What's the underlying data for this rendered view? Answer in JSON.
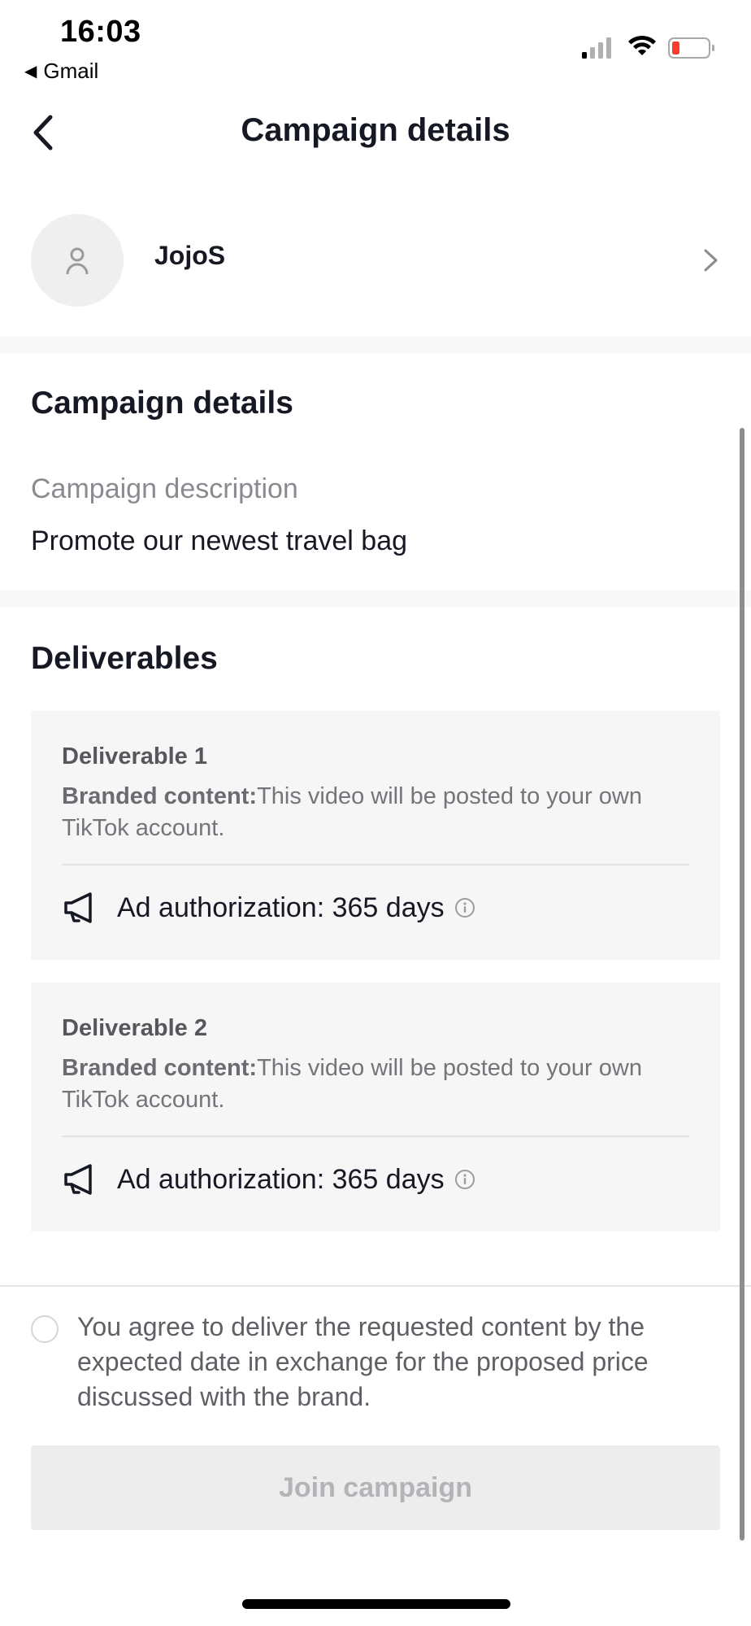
{
  "status_bar": {
    "time": "16:03",
    "back_app": "Gmail",
    "battery_level_color": "#ff3b30"
  },
  "nav": {
    "title": "Campaign details"
  },
  "creator": {
    "name": "JojoS"
  },
  "campaign": {
    "section_title": "Campaign details",
    "description_label": "Campaign description",
    "description": "Promote our newest travel bag"
  },
  "deliverables": {
    "section_title": "Deliverables",
    "items": [
      {
        "title": "Deliverable 1",
        "type_label": "Branded content:",
        "type_desc": "This video will be posted to your own TikTok account.",
        "authorization": "Ad authorization: 365 days"
      },
      {
        "title": "Deliverable 2",
        "type_label": "Branded content:",
        "type_desc": "This video will be posted to your own TikTok account.",
        "authorization": "Ad authorization: 365 days"
      }
    ]
  },
  "agreement": {
    "text": "You agree to deliver the requested content by the expected date in exchange for the proposed price discussed with the brand.",
    "checked": false
  },
  "actions": {
    "join_label": "Join campaign"
  }
}
